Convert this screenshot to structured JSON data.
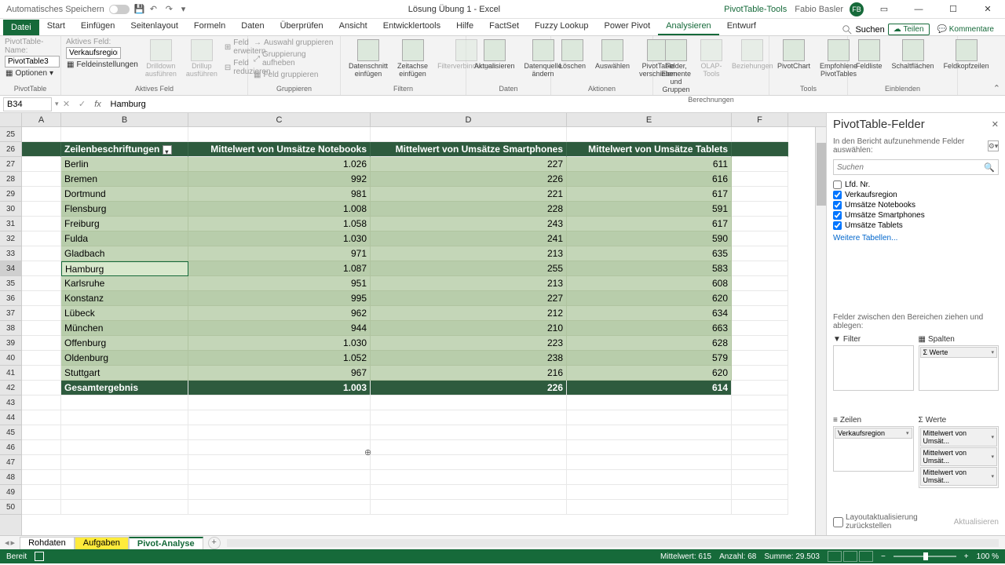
{
  "titlebar": {
    "autosave": "Automatisches Speichern",
    "filename": "Lösung Übung 1 - Excel",
    "context_tab": "PivotTable-Tools",
    "user": "Fabio Basler",
    "user_initials": "FB"
  },
  "tabs": {
    "file": "Datei",
    "items": [
      "Start",
      "Einfügen",
      "Seitenlayout",
      "Formeln",
      "Daten",
      "Überprüfen",
      "Ansicht",
      "Entwicklertools",
      "Hilfe",
      "FactSet",
      "Fuzzy Lookup",
      "Power Pivot",
      "Analysieren",
      "Entwurf"
    ],
    "active": "Analysieren",
    "search": "Suchen",
    "share": "Teilen",
    "comments": "Kommentare"
  },
  "ribbon": {
    "pivot_name_label": "PivotTable-Name:",
    "pivot_name_value": "PivotTable3",
    "options_btn": "Optionen",
    "group_pivottable": "PivotTable",
    "active_field_label": "Aktives Feld:",
    "active_field_value": "Verkaufsregion",
    "field_settings": "Feldeinstellungen",
    "drilldown": "Drilldown ausführen",
    "drillup": "Drillup ausführen",
    "expand_field": "Feld erweitern",
    "collapse_field": "Feld reduzieren",
    "group_active_field": "Aktives Feld",
    "group_selection": "Auswahl gruppieren",
    "ungroup": "Gruppierung aufheben",
    "group_field": "Feld gruppieren",
    "group_group": "Gruppieren",
    "insert_slicer": "Datenschnitt einfügen",
    "insert_timeline": "Zeitachse einfügen",
    "filter_connections": "Filterverbindungen",
    "group_filter": "Filtern",
    "refresh": "Aktualisieren",
    "change_source": "Datenquelle ändern",
    "group_data": "Daten",
    "clear": "Löschen",
    "select": "Auswählen",
    "move": "PivotTable verschieben",
    "group_actions": "Aktionen",
    "fields_items": "Felder, Elemente und Gruppen",
    "olap_tools": "OLAP-Tools",
    "relationships": "Beziehungen",
    "group_calc": "Berechnungen",
    "pivotchart": "PivotChart",
    "recommended": "Empfohlene PivotTables",
    "group_tools": "Tools",
    "field_list": "Feldliste",
    "buttons": "Schaltflächen",
    "headers": "Feldkopfzeilen",
    "group_show": "Einblenden"
  },
  "formula_bar": {
    "name_box": "B34",
    "value": "Hamburg"
  },
  "columns": [
    "A",
    "B",
    "C",
    "D",
    "E",
    "F"
  ],
  "row_start": 25,
  "row_count": 26,
  "selected_row": 34,
  "pivot": {
    "header_row": 26,
    "headers": [
      "Zeilenbeschriftungen",
      "Mittelwert von Umsätze Notebooks",
      "Mittelwert von Umsätze Smartphones",
      "Mittelwert von Umsätze Tablets"
    ],
    "rows": [
      {
        "r": 27,
        "label": "Berlin",
        "v": [
          "1.026",
          "227",
          "611"
        ]
      },
      {
        "r": 28,
        "label": "Bremen",
        "v": [
          "992",
          "226",
          "616"
        ]
      },
      {
        "r": 29,
        "label": "Dortmund",
        "v": [
          "981",
          "221",
          "617"
        ]
      },
      {
        "r": 30,
        "label": "Flensburg",
        "v": [
          "1.008",
          "228",
          "591"
        ]
      },
      {
        "r": 31,
        "label": "Freiburg",
        "v": [
          "1.058",
          "243",
          "617"
        ]
      },
      {
        "r": 32,
        "label": "Fulda",
        "v": [
          "1.030",
          "241",
          "590"
        ]
      },
      {
        "r": 33,
        "label": "Gladbach",
        "v": [
          "971",
          "213",
          "635"
        ]
      },
      {
        "r": 34,
        "label": "Hamburg",
        "v": [
          "1.087",
          "255",
          "583"
        ]
      },
      {
        "r": 35,
        "label": "Karlsruhe",
        "v": [
          "951",
          "213",
          "608"
        ]
      },
      {
        "r": 36,
        "label": "Konstanz",
        "v": [
          "995",
          "227",
          "620"
        ]
      },
      {
        "r": 37,
        "label": "Lübeck",
        "v": [
          "962",
          "212",
          "634"
        ]
      },
      {
        "r": 38,
        "label": "München",
        "v": [
          "944",
          "210",
          "663"
        ]
      },
      {
        "r": 39,
        "label": "Offenburg",
        "v": [
          "1.030",
          "223",
          "628"
        ]
      },
      {
        "r": 40,
        "label": "Oldenburg",
        "v": [
          "1.052",
          "238",
          "579"
        ]
      },
      {
        "r": 41,
        "label": "Stuttgart",
        "v": [
          "967",
          "216",
          "620"
        ]
      }
    ],
    "total": {
      "r": 42,
      "label": "Gesamtergebnis",
      "v": [
        "1.003",
        "226",
        "614"
      ]
    }
  },
  "pane": {
    "title": "PivotTable-Felder",
    "subtitle": "In den Bericht aufzunehmende Felder auswählen:",
    "search_placeholder": "Suchen",
    "fields": [
      {
        "name": "Lfd. Nr.",
        "checked": false
      },
      {
        "name": "Verkaufsregion",
        "checked": true
      },
      {
        "name": "Umsätze Notebooks",
        "checked": true
      },
      {
        "name": "Umsätze Smartphones",
        "checked": true
      },
      {
        "name": "Umsätze Tablets",
        "checked": true
      }
    ],
    "more_tables": "Weitere Tabellen...",
    "drag_hint": "Felder zwischen den Bereichen ziehen und ablegen:",
    "area_filter": "Filter",
    "area_columns": "Spalten",
    "area_rows": "Zeilen",
    "area_values": "Werte",
    "columns_items": [
      "Σ Werte"
    ],
    "rows_items": [
      "Verkaufsregion"
    ],
    "values_items": [
      "Mittelwert von Umsät...",
      "Mittelwert von Umsät...",
      "Mittelwert von Umsät..."
    ],
    "defer_layout": "Layoutaktualisierung zurückstellen",
    "update": "Aktualisieren"
  },
  "sheets": {
    "items": [
      "Rohdaten",
      "Aufgaben",
      "Pivot-Analyse"
    ],
    "active": "Pivot-Analyse",
    "yellow": "Aufgaben"
  },
  "status": {
    "ready": "Bereit",
    "avg": "Mittelwert: 615",
    "count": "Anzahl: 68",
    "sum": "Summe: 29.503",
    "zoom": "100 %"
  }
}
